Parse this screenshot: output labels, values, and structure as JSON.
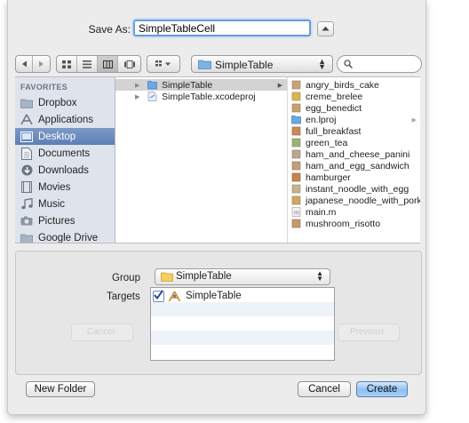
{
  "save_as": {
    "label": "Save As:",
    "value": "SimpleTableCell"
  },
  "toolbar": {
    "path_popup_label": "SimpleTable",
    "search_placeholder": ""
  },
  "sidebar": {
    "heading": "FAVORITES",
    "items": [
      {
        "label": "Dropbox",
        "icon": "folder-icon"
      },
      {
        "label": "Applications",
        "icon": "applications-icon"
      },
      {
        "label": "Desktop",
        "icon": "desktop-icon",
        "selected": true
      },
      {
        "label": "Documents",
        "icon": "documents-icon"
      },
      {
        "label": "Downloads",
        "icon": "downloads-icon"
      },
      {
        "label": "Movies",
        "icon": "movies-icon"
      },
      {
        "label": "Music",
        "icon": "music-icon"
      },
      {
        "label": "Pictures",
        "icon": "pictures-icon"
      },
      {
        "label": "Google Drive",
        "icon": "folder-icon"
      }
    ]
  },
  "column2": {
    "items": [
      {
        "label": "SimpleTable",
        "selected": true
      },
      {
        "label": "SimpleTable.xcodeproj"
      }
    ]
  },
  "column3": {
    "items": [
      "angry_birds_cake",
      "creme_brelee",
      "egg_benedict",
      "en.lproj",
      "full_breakfast",
      "green_tea",
      "ham_and_cheese_panini",
      "ham_and_egg_sandwich",
      "hamburger",
      "instant_noodle_with_egg",
      "japanese_noodle_with_pork",
      "main.m",
      "mushroom_risotto"
    ]
  },
  "options": {
    "group_label": "Group",
    "group_value": "SimpleTable",
    "targets_label": "Targets",
    "targets": [
      {
        "label": "SimpleTable",
        "checked": true
      }
    ],
    "ghost_cancel": "Cancel",
    "ghost_previous": "Previous"
  },
  "buttons": {
    "new_folder": "New Folder",
    "cancel": "Cancel",
    "create": "Create"
  },
  "colors": {
    "sidebar_bg": "#dfe4ec",
    "selection": "#5c7fb6",
    "default_button": "#8dbff1"
  }
}
